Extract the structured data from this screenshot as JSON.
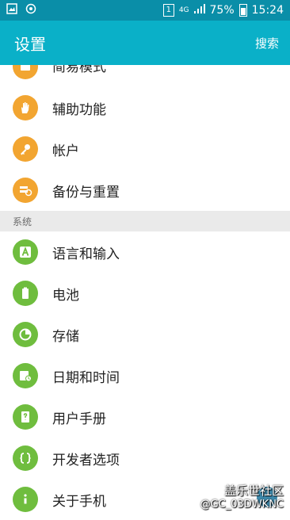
{
  "status_bar": {
    "sim_label": "1",
    "network": "4G",
    "battery": "75%",
    "time": "15:24"
  },
  "app_bar": {
    "title": "设置",
    "search_label": "搜索"
  },
  "items_top": [
    {
      "label": "简易模式",
      "icon": "simple-mode-icon"
    },
    {
      "label": "辅助功能",
      "icon": "hand-icon"
    },
    {
      "label": "帐户",
      "icon": "key-icon"
    },
    {
      "label": "备份与重置",
      "icon": "backup-icon"
    }
  ],
  "section_system": "系统",
  "items_system": [
    {
      "label": "语言和输入",
      "icon": "language-icon"
    },
    {
      "label": "电池",
      "icon": "battery-icon"
    },
    {
      "label": "存储",
      "icon": "storage-icon"
    },
    {
      "label": "日期和时间",
      "icon": "calendar-clock-icon"
    },
    {
      "label": "用户手册",
      "icon": "manual-icon"
    },
    {
      "label": "开发者选项",
      "icon": "developer-icon"
    },
    {
      "label": "关于手机",
      "icon": "info-icon"
    }
  ],
  "watermark": {
    "line1": "盖乐世社区",
    "line2": "@GC_03DWKNC"
  },
  "colors": {
    "status_bar": "#0a8ea8",
    "app_bar": "#0ab0c8",
    "orange_icon": "#f2a531",
    "green_icon": "#6fbd3e",
    "section_bg": "#eaeaea"
  }
}
